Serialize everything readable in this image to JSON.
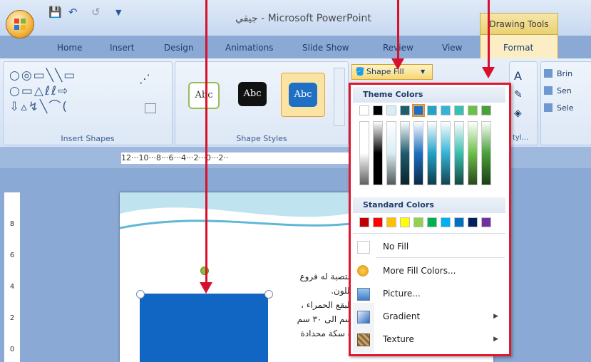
{
  "window": {
    "title": "جيقي - Microsoft PowerPoint",
    "contextual_tab_group": "Drawing Tools"
  },
  "tabs": [
    "Home",
    "Insert",
    "Design",
    "Animations",
    "Slide Show",
    "Review",
    "View",
    "Format"
  ],
  "active_tab": "Format",
  "ribbon": {
    "insert_shapes_label": "Insert Shapes",
    "shape_styles_label": "Shape Styles",
    "style_sample_text": "Abc",
    "shape_fill_label": "Shape Fill",
    "wordart_group_label": "tyl...",
    "arrange_items": [
      "Brin",
      "Sen",
      "Sele"
    ]
  },
  "ruler": {
    "top_text": "12···10···8···6···4···2···0···2··",
    "left_numbers": [
      "8",
      "6",
      "4",
      "2",
      "0"
    ]
  },
  "slide": {
    "arabic_lines": [
      "متصبة له فروع",
      "اللون.",
      "البقع الحمراء ،",
      "سم الى ٣٠ سم",
      "ة سكة محدادة"
    ]
  },
  "dropdown": {
    "theme_colors_label": "Theme Colors",
    "standard_colors_label": "Standard Colors",
    "theme_top_row": [
      "#ffffff",
      "#000000",
      "#d9eef3",
      "#1f5c6e",
      "#1e6fc0",
      "#22a3c8",
      "#34b3d6",
      "#38c0b0",
      "#6cc04a",
      "#4aa03a"
    ],
    "standard_colors": [
      "#c00000",
      "#ff0000",
      "#ffc000",
      "#ffff00",
      "#92d050",
      "#00b050",
      "#00b0f0",
      "#0070c0",
      "#002060",
      "#7030a0"
    ],
    "menu_items": [
      {
        "label": "No Fill",
        "submenu": false
      },
      {
        "label": "More Fill Colors...",
        "submenu": false
      },
      {
        "label": "Picture...",
        "submenu": false
      },
      {
        "label": "Gradient",
        "submenu": true
      },
      {
        "label": "Texture",
        "submenu": true
      }
    ]
  }
}
